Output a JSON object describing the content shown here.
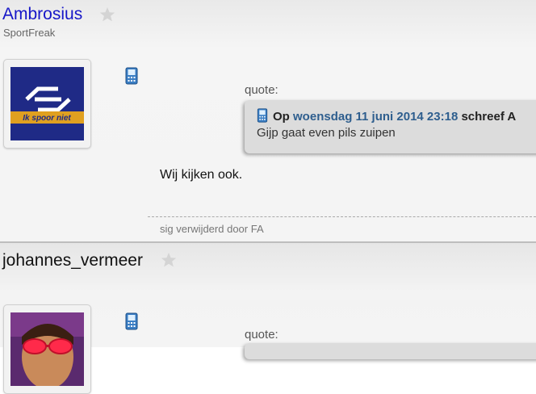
{
  "posts": [
    {
      "username": "Ambrosius",
      "rank": "SportFreak",
      "avatar_text": "Ik spoor niet",
      "quote": {
        "label": "quote:",
        "op": "Op",
        "date": "woensdag 11 juni 2014 23:18",
        "wrote": "schreef A",
        "body": "Gijp gaat even pils zuipen"
      },
      "message": "Wij kijken ook.",
      "signature": "sig verwijderd door FA"
    },
    {
      "username": "johannes_vermeer",
      "quote": {
        "label": "quote:"
      }
    }
  ],
  "colors": {
    "username_link": "#1616c8",
    "date_link": "#2e5e8e",
    "quote_bg": "#dcdcdc"
  },
  "icons": [
    "star-icon",
    "mobile-phone-icon"
  ]
}
